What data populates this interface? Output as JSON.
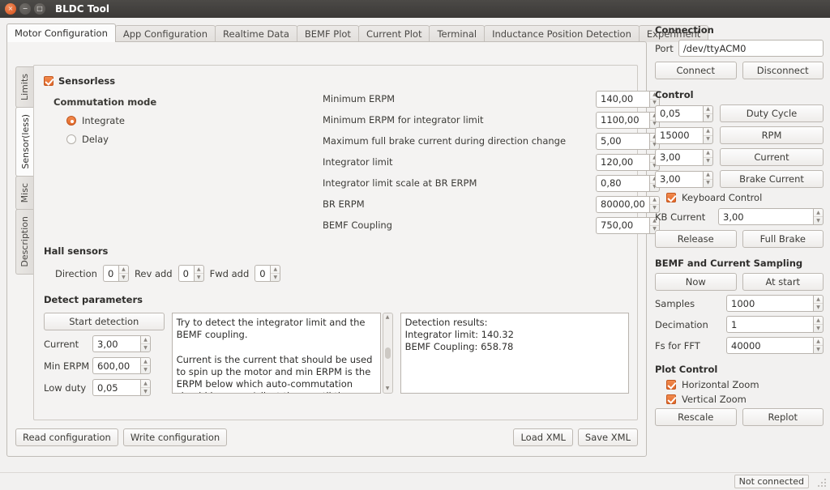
{
  "window": {
    "title": "BLDC Tool",
    "controls": [
      {
        "name": "close",
        "glyph": "×"
      },
      {
        "name": "minimize",
        "glyph": "−"
      },
      {
        "name": "maximize",
        "glyph": "□"
      }
    ]
  },
  "tabs": [
    {
      "label": "Motor Configuration",
      "active": true
    },
    {
      "label": "App Configuration",
      "active": false
    },
    {
      "label": "Realtime Data",
      "active": false
    },
    {
      "label": "BEMF Plot",
      "active": false
    },
    {
      "label": "Current Plot",
      "active": false
    },
    {
      "label": "Terminal",
      "active": false
    },
    {
      "label": "Inductance Position Detection",
      "active": false
    },
    {
      "label": "Experiment",
      "active": false
    }
  ],
  "vtabs": [
    {
      "label": "Limits",
      "active": false
    },
    {
      "label": "Sensor(less)",
      "active": true
    },
    {
      "label": "Misc",
      "active": false
    },
    {
      "label": "Description",
      "active": false
    }
  ],
  "sensorless": {
    "checkbox_label": "Sensorless",
    "checked": true,
    "commutation_mode_label": "Commutation mode",
    "modes": [
      {
        "label": "Integrate",
        "selected": true
      },
      {
        "label": "Delay",
        "selected": false
      }
    ]
  },
  "params": [
    {
      "label": "Minimum ERPM",
      "value": "140,00"
    },
    {
      "label": "Minimum ERPM for integrator limit",
      "value": "1100,00"
    },
    {
      "label": "Maximum full brake current during direction change",
      "value": "5,00"
    },
    {
      "label": "Integrator limit",
      "value": "120,00"
    },
    {
      "label": "Integrator limit scale at BR ERPM",
      "value": "0,80"
    },
    {
      "label": "BR ERPM",
      "value": "80000,00"
    },
    {
      "label": "BEMF Coupling",
      "value": "750,00"
    }
  ],
  "hall": {
    "title": "Hall sensors",
    "fields": [
      {
        "label": "Direction",
        "value": "0"
      },
      {
        "label": "Rev add",
        "value": "0"
      },
      {
        "label": "Fwd add",
        "value": "0"
      }
    ]
  },
  "detect": {
    "title": "Detect parameters",
    "start_button": "Start detection",
    "fields": [
      {
        "label": "Current",
        "value": "3,00"
      },
      {
        "label": "Min ERPM",
        "value": "600,00"
      },
      {
        "label": "Low duty",
        "value": "0,05"
      }
    ],
    "help_text": "Try to detect the integrator limit and the BEMF coupling.\n\nCurrent is the current that should be used to spin up the motor and min ERPM is the ERPM below which auto-commutation should happen. Adjust them until the motor is able to spin up",
    "results_text": "Detection results:\nIntegrator limit: 140.32\nBEMF Coupling: 658.78"
  },
  "bottom_bar": {
    "read_configuration": "Read configuration",
    "write_configuration": "Write configuration",
    "load_xml": "Load XML",
    "save_xml": "Save XML"
  },
  "sidebar": {
    "connection": {
      "title": "Connection",
      "port_label": "Port",
      "port_value": "/dev/ttyACM0",
      "connect": "Connect",
      "disconnect": "Disconnect"
    },
    "control": {
      "title": "Control",
      "rows": [
        {
          "value": "0,05",
          "button": "Duty Cycle"
        },
        {
          "value": "15000",
          "button": "RPM"
        },
        {
          "value": "3,00",
          "button": "Current"
        },
        {
          "value": "3,00",
          "button": "Brake Current"
        }
      ],
      "keyboard_control_label": "Keyboard Control",
      "keyboard_control_checked": true,
      "kb_current_label": "KB Current",
      "kb_current_value": "3,00",
      "release": "Release",
      "full_brake": "Full Brake"
    },
    "sampling": {
      "title": "BEMF and Current Sampling",
      "now": "Now",
      "at_start": "At start",
      "fields": [
        {
          "label": "Samples",
          "value": "1000"
        },
        {
          "label": "Decimation",
          "value": "1"
        },
        {
          "label": "Fs for FFT",
          "value": "40000"
        }
      ]
    },
    "plot_control": {
      "title": "Plot Control",
      "horizontal_zoom_label": "Horizontal Zoom",
      "horizontal_zoom_checked": true,
      "vertical_zoom_label": "Vertical Zoom",
      "vertical_zoom_checked": true,
      "rescale": "Rescale",
      "replot": "Replot"
    }
  },
  "statusbar": {
    "text": "Not connected"
  },
  "colors": {
    "accent": "#e2682a",
    "titlebar": "#3b3937",
    "panel_bg": "#f4f3f2",
    "window_bg": "#f2f1f0"
  }
}
